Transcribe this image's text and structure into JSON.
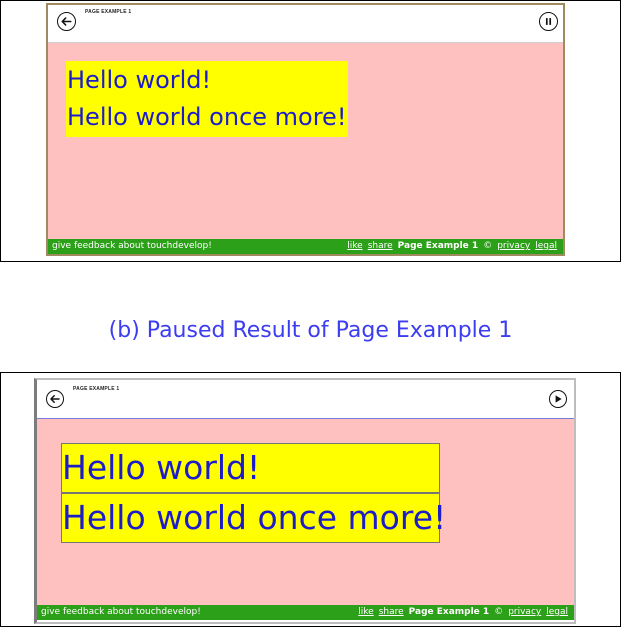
{
  "panel_top": {
    "page_title": "PAGE EXAMPLE 1",
    "back_icon": "back-arrow-icon",
    "pause_icon": "pause-icon",
    "content_lines": [
      "Hello world!",
      "Hello world once more!"
    ],
    "footer": {
      "feedback": "give feedback about touchdevelop!",
      "links": [
        "like",
        "share"
      ],
      "page_name": "Page Example 1",
      "copyright": "©",
      "tail_links": [
        "privacy",
        "legal"
      ]
    }
  },
  "caption": "(b) Paused Result of Page Example 1",
  "panel_bottom": {
    "page_title": "PAGE EXAMPLE 1",
    "back_icon": "back-arrow-icon",
    "play_icon": "play-icon",
    "content_lines": [
      "Hello world!",
      "Hello world once more!"
    ],
    "footer": {
      "feedback": "give feedback about touchdevelop!",
      "links": [
        "like",
        "share"
      ],
      "page_name": "Page Example 1",
      "copyright": "©",
      "tail_links": [
        "privacy",
        "legal"
      ]
    }
  },
  "colors": {
    "content_bg": "#ffc0c0",
    "text_box": "#ffff00",
    "text": "#1c1cc8",
    "footer": "#2da019",
    "caption": "#3c3cf0"
  }
}
